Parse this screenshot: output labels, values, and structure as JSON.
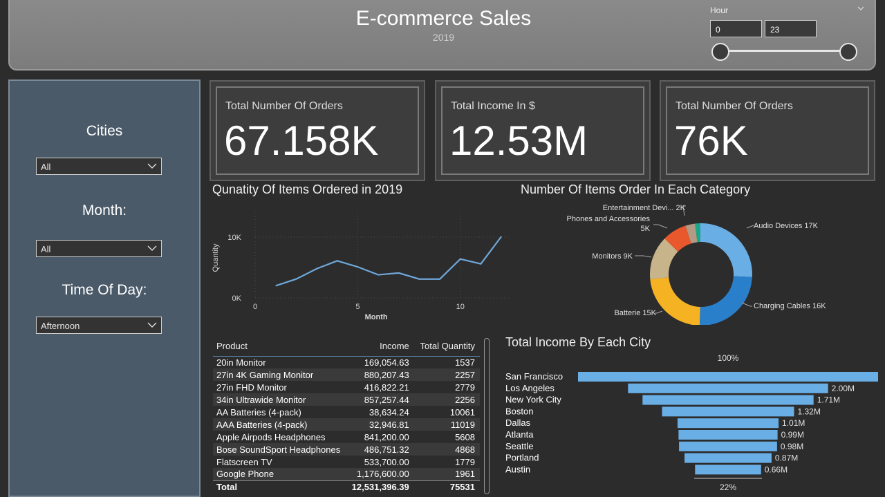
{
  "header": {
    "title": "E-commerce Sales",
    "subtitle": "2019",
    "hour_slicer": {
      "label": "Hour",
      "min_value": "0",
      "max_value": "23"
    }
  },
  "sidebar": {
    "cities_label": "Cities",
    "cities_value": "All",
    "month_label": "Month:",
    "month_value": "All",
    "time_label": "Time Of Day:",
    "time_value": "Afternoon"
  },
  "kpis": [
    {
      "label": "Total Number Of Orders",
      "value": "67.158K"
    },
    {
      "label": "Total Income In $",
      "value": "12.53M"
    },
    {
      "label": "Total Number Of Orders",
      "value": "76K"
    }
  ],
  "line_chart_title": "Qunatity Of Items Ordered in 2019",
  "donut_title": "Number Of Items Order In Each Category",
  "funnel_title": "Total Income By Each City",
  "table": {
    "columns": [
      "Product",
      "Income",
      "Total Quantity"
    ],
    "rows": [
      [
        "20in Monitor",
        "169,054.63",
        "1537"
      ],
      [
        "27in 4K Gaming Monitor",
        "880,207.43",
        "2257"
      ],
      [
        "27in FHD Monitor",
        "416,822.21",
        "2779"
      ],
      [
        "34in Ultrawide Monitor",
        "857,257.44",
        "2256"
      ],
      [
        "AA Batteries (4-pack)",
        "38,634.24",
        "10061"
      ],
      [
        "AAA Batteries (4-pack)",
        "32,946.81",
        "11019"
      ],
      [
        "Apple Airpods Headphones",
        "841,200.00",
        "5608"
      ],
      [
        "Bose SoundSport Headphones",
        "486,751.32",
        "4868"
      ],
      [
        "Flatscreen TV",
        "533,700.00",
        "1779"
      ],
      [
        "Google Phone",
        "1,176,600.00",
        "1961"
      ]
    ],
    "total": [
      "Total",
      "12,531,396.39",
      "75531"
    ]
  },
  "chart_data": [
    {
      "type": "line",
      "title": "Qunatity Of Items Ordered in 2019",
      "xlabel": "Month",
      "ylabel": "Quantity",
      "x": [
        1,
        2,
        3,
        4,
        5,
        6,
        7,
        8,
        9,
        10,
        11,
        12
      ],
      "series": [
        {
          "values": [
            2000,
            3100,
            4800,
            6100,
            5100,
            3800,
            4100,
            3100,
            3100,
            6400,
            5600,
            10100
          ]
        }
      ],
      "xticks": [
        "0",
        "5",
        "10"
      ],
      "yticks": [
        "0K",
        "10K"
      ],
      "xlim": [
        0,
        12.5
      ],
      "ylim": [
        0,
        10000
      ],
      "grid": false,
      "color": "#6fa8dc"
    },
    {
      "type": "pie",
      "title": "Number Of Items Order In Each Category",
      "donut": true,
      "slices": [
        {
          "label": "Audio Devices 17K",
          "value": 17,
          "color": "#6aaee6"
        },
        {
          "label": "Charging Cables 16K",
          "value": 16,
          "color": "#2a7fca"
        },
        {
          "label": "Batterie 15K",
          "value": 15,
          "color": "#f5b324"
        },
        {
          "label": "Monitors 9K",
          "value": 9,
          "color": "#c8b48a"
        },
        {
          "label": "Phones and Accessories 5K",
          "value": 5,
          "color": "#e8582c"
        },
        {
          "label": "2K",
          "value": 2,
          "color": "#b39a84"
        },
        {
          "label": "Entertainment Devi...",
          "value": 1,
          "color": "#18a889"
        }
      ],
      "label_lines": [
        {
          "text": "Audio Devices 17K"
        },
        {
          "text": "Charging Cables 16K"
        },
        {
          "text": "Batterie 15K"
        },
        {
          "text": "Monitors 9K"
        },
        {
          "text": "Phones and Accessories"
        },
        {
          "text": "5K"
        },
        {
          "text": "Entertainment Devi...  2K"
        }
      ]
    },
    {
      "type": "bar",
      "subtype": "funnel",
      "title": "Total Income By Each City",
      "categories": [
        "San Francisco",
        "Los Angeles",
        "New York City",
        "Boston",
        "Dallas",
        "Atlanta",
        "Seattle",
        "Portland",
        "Austin"
      ],
      "values": [
        3.0,
        2.0,
        1.71,
        1.32,
        1.01,
        0.99,
        0.98,
        0.87,
        0.66
      ],
      "value_labels": [
        "",
        "2.00M",
        "1.71M",
        "1.32M",
        "1.01M",
        "0.99M",
        "0.98M",
        "0.87M",
        "0.66M"
      ],
      "top_label": "100%",
      "bottom_label": "22%",
      "color": "#6aaee6"
    }
  ]
}
